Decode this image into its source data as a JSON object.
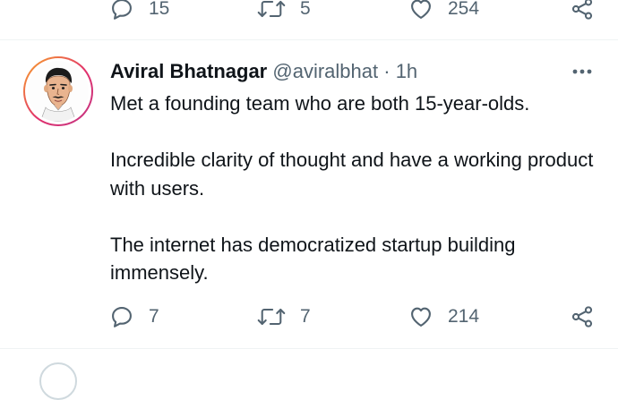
{
  "previous_tweet": {
    "actions": {
      "reply_count": "15",
      "retweet_count": "5",
      "like_count": "254"
    }
  },
  "tweet": {
    "author": {
      "name": "Aviral Bhatnagar",
      "handle": "@aviralbhat",
      "separator": "·",
      "time": "1h"
    },
    "paragraphs": [
      "Met a founding team who are both 15-year-olds.",
      "Incredible clarity of thought and have a working product with users.",
      "The internet has democratized startup building immensely."
    ],
    "actions": {
      "reply_count": "7",
      "retweet_count": "7",
      "like_count": "214"
    }
  },
  "icons": {
    "reply": "reply-icon",
    "retweet": "retweet-icon",
    "like": "heart-icon",
    "share": "share-icon",
    "more": "more-options-icon"
  },
  "colors": {
    "text_primary": "#0f1419",
    "text_secondary": "#536471",
    "divider": "#eff3f4"
  }
}
